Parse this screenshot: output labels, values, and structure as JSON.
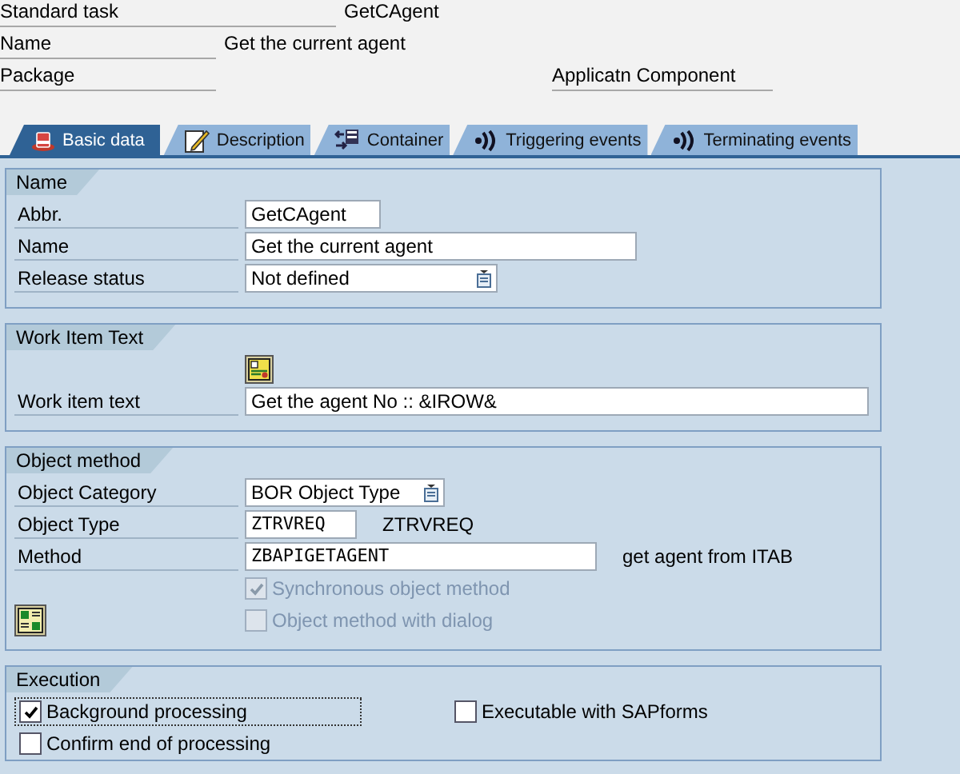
{
  "header": [
    {
      "kind": "pair",
      "label": "Standard task",
      "value": "GetCAgent"
    },
    {
      "kind": "pair",
      "label": "Name",
      "value": "Get the current agent"
    },
    {
      "kind": "pair",
      "label": "Package",
      "extra_label": "Applicatn Component"
    }
  ],
  "tabs": [
    {
      "label": "Basic data",
      "selected": true
    },
    {
      "label": "Description",
      "selected": false
    },
    {
      "label": "Container",
      "selected": false
    },
    {
      "label": "Triggering events",
      "selected": false
    },
    {
      "label": "Terminating events",
      "selected": false
    }
  ],
  "sections": [
    {
      "title": "Name",
      "rows": [
        {
          "kind": "field",
          "label": "Abbr.",
          "value": "GetCAgent"
        },
        {
          "kind": "field",
          "label": "Name",
          "value": "Get the current agent"
        },
        {
          "kind": "dropdown",
          "label": "Release status",
          "value": "Not defined"
        }
      ]
    },
    {
      "title": "Work Item Text",
      "rows": [
        {
          "kind": "tool"
        },
        {
          "kind": "field",
          "label": "Work item text",
          "value": "Get the agent No :: &IROW&"
        }
      ]
    },
    {
      "title": "Object method",
      "rows": [
        {
          "kind": "dropdown",
          "label": "Object Category",
          "value": "BOR Object Type"
        },
        {
          "kind": "field",
          "label": "Object Type",
          "value": "ZTRVREQ",
          "note": "ZTRVREQ"
        },
        {
          "kind": "field",
          "label": "Method",
          "value": "ZBAPIGETAGENT",
          "note": "get agent from ITAB"
        },
        {
          "kind": "checkbox",
          "label": "Synchronous object method",
          "checked": true,
          "disabled": true
        },
        {
          "kind": "tool-checkbox",
          "label": "Object method with dialog",
          "checked": false,
          "disabled": true
        }
      ]
    },
    {
      "title": "Execution",
      "rows": [
        {
          "kind": "checkbox-pair",
          "items": [
            {
              "label": "Background processing",
              "checked": true,
              "focused": true
            },
            {
              "label": "Executable with SAPforms",
              "checked": false,
              "focused": false
            }
          ]
        },
        {
          "kind": "checkbox-pair",
          "items": [
            {
              "label": "Confirm end of processing",
              "checked": false,
              "focused": false
            }
          ]
        }
      ]
    }
  ]
}
